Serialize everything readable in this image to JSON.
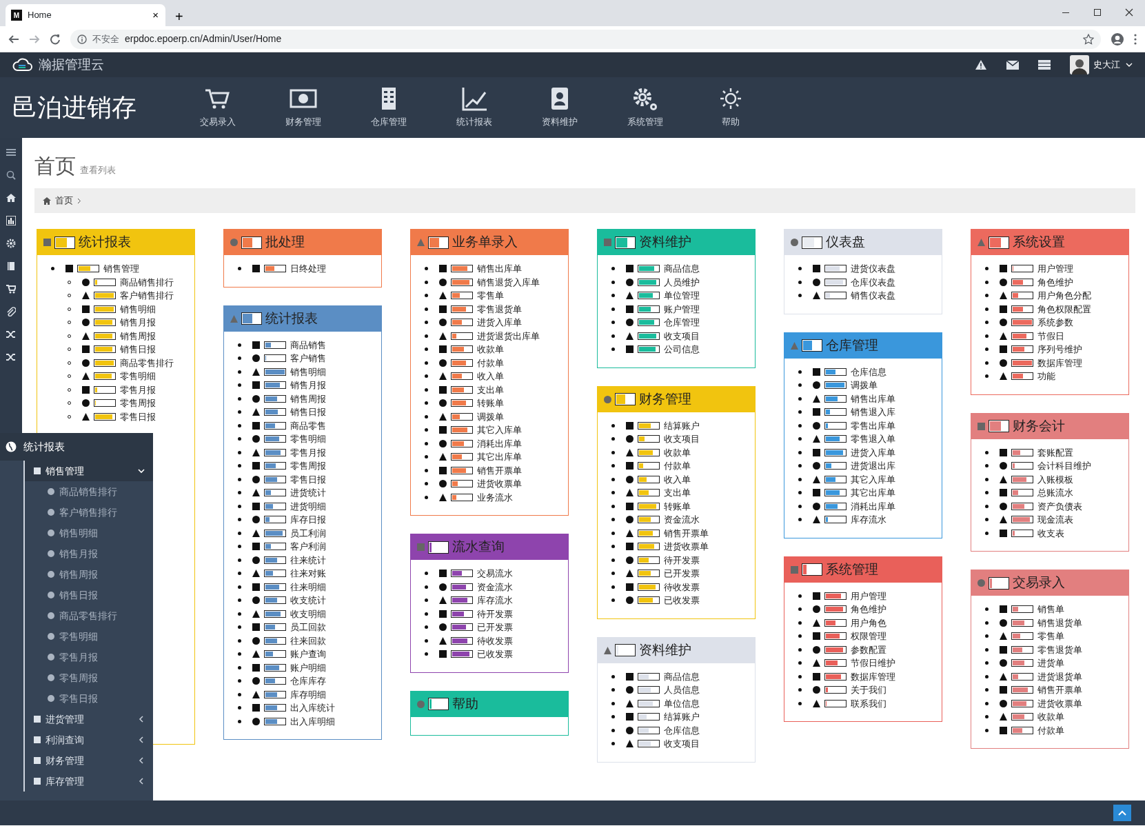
{
  "browser": {
    "favicon": "M",
    "tab_title": "Home",
    "tab_close": "×",
    "new_tab": "+",
    "security": "不安全",
    "url": "erpdoc.epoerp.cn/Admin/User/Home"
  },
  "app_bar": {
    "brand": "瀚据管理云",
    "user": "史大江"
  },
  "product_name": "邑泊进销存",
  "modules": [
    {
      "label": "交易录入"
    },
    {
      "label": "财务管理"
    },
    {
      "label": "仓库管理"
    },
    {
      "label": "统计报表"
    },
    {
      "label": "资料维护"
    },
    {
      "label": "系统管理"
    },
    {
      "label": "帮助"
    }
  ],
  "page": {
    "title": "首页",
    "subtitle": "查看列表",
    "breadcrumb": [
      "首页"
    ]
  },
  "columns": [
    [
      {
        "title": "统计报表",
        "color": "#f1c40f",
        "level": 0.6,
        "items": [
          {
            "label": "销售管理",
            "level": 0.6,
            "children": [
              {
                "label": "商品销售排行",
                "level": 0.1
              },
              {
                "label": "客户销售排行",
                "level": 0.95
              },
              {
                "label": "销售明细",
                "level": 0.95
              },
              {
                "label": "销售月报",
                "level": 0.9
              },
              {
                "label": "销售周报",
                "level": 0.9
              },
              {
                "label": "销售日报",
                "level": 0.9
              },
              {
                "label": "商品零售排行",
                "level": 0.95
              },
              {
                "label": "零售明细",
                "level": 0.85
              },
              {
                "label": "零售月报",
                "level": 0.1
              },
              {
                "label": "零售周报",
                "level": 0.05
              },
              {
                "label": "零售日报",
                "level": 0.9
              }
            ]
          }
        ]
      }
    ],
    [
      {
        "title": "批处理",
        "color": "#f07a4a",
        "level": 0.55,
        "items": [
          {
            "label": "日终处理",
            "level": 0.45
          }
        ]
      },
      {
        "title": "统计报表",
        "color": "#5b8ec4",
        "level": 0.55,
        "items": [
          {
            "label": "商品销售",
            "level": 0.3
          },
          {
            "label": "客户销售",
            "level": 0.05
          },
          {
            "label": "销售明细",
            "level": 1
          },
          {
            "label": "销售月报",
            "level": 0.75
          },
          {
            "label": "销售周报",
            "level": 0.6
          },
          {
            "label": "销售日报",
            "level": 0.65
          },
          {
            "label": "商品零售",
            "level": 0.5
          },
          {
            "label": "零售明细",
            "level": 0.7
          },
          {
            "label": "零售月报",
            "level": 0.8
          },
          {
            "label": "零售周报",
            "level": 0.55
          },
          {
            "label": "零售日报",
            "level": 0.6
          },
          {
            "label": "进货统计",
            "level": 0.3
          },
          {
            "label": "进货明细",
            "level": 0.4
          },
          {
            "label": "库存日报",
            "level": 0.2
          },
          {
            "label": "员工利润",
            "level": 0.9
          },
          {
            "label": "客户利润",
            "level": 0.3
          },
          {
            "label": "往来统计",
            "level": 0.6
          },
          {
            "label": "往来对账",
            "level": 0.4
          },
          {
            "label": "往来明细",
            "level": 0.7
          },
          {
            "label": "收支统计",
            "level": 0.6
          },
          {
            "label": "收支明细",
            "level": 0.8
          },
          {
            "label": "员工回款",
            "level": 0.5
          },
          {
            "label": "往来回款",
            "level": 0.6
          },
          {
            "label": "账户查询",
            "level": 0.4
          },
          {
            "label": "账户明细",
            "level": 0.7
          },
          {
            "label": "仓库库存",
            "level": 0.5
          },
          {
            "label": "库存明细",
            "level": 0.6
          },
          {
            "label": "出入库统计",
            "level": 0.6
          },
          {
            "label": "出入库明细",
            "level": 0.6
          }
        ]
      }
    ],
    [
      {
        "title": "业务单录入",
        "color": "#f07a4a",
        "level": 0.55,
        "items": [
          {
            "label": "销售出库单",
            "level": 0.8
          },
          {
            "label": "销售退货入库单",
            "level": 0.9
          },
          {
            "label": "零售单",
            "level": 0.4
          },
          {
            "label": "零售退货单",
            "level": 0.7
          },
          {
            "label": "进货入库单",
            "level": 0.5
          },
          {
            "label": "进货退货出库单",
            "level": 0.2
          },
          {
            "label": "收款单",
            "level": 0.6
          },
          {
            "label": "付款单",
            "level": 0.7
          },
          {
            "label": "收入单",
            "level": 0.5
          },
          {
            "label": "支出单",
            "level": 0.6
          },
          {
            "label": "转账单",
            "level": 0.7
          },
          {
            "label": "调拨单",
            "level": 0.4
          },
          {
            "label": "其它入库单",
            "level": 0.8
          },
          {
            "label": "消耗出库单",
            "level": 0.6
          },
          {
            "label": "其它出库单",
            "level": 0.5
          },
          {
            "label": "销售开票单",
            "level": 0.7
          },
          {
            "label": "进货收票单",
            "level": 0.3
          },
          {
            "label": "业务流水",
            "level": 0.2
          }
        ]
      },
      {
        "title": "流水查询",
        "color": "#8e44ad",
        "level": 0.1,
        "items": [
          {
            "label": "交易流水",
            "level": 0.5
          },
          {
            "label": "资金流水",
            "level": 0.7
          },
          {
            "label": "库存流水",
            "level": 0.8
          },
          {
            "label": "待开发票",
            "level": 0.6
          },
          {
            "label": "已开发票",
            "level": 0.7
          },
          {
            "label": "待收发票",
            "level": 0.8
          },
          {
            "label": "已收发票",
            "level": 0.9
          }
        ]
      },
      {
        "title": "帮助",
        "color": "#1abc9c",
        "level": 0.1
      }
    ],
    [
      {
        "title": "资料维护",
        "color": "#1abc9c",
        "level": 0.6,
        "items": [
          {
            "label": "商品信息",
            "level": 0.8
          },
          {
            "label": "人员维护",
            "level": 0.9
          },
          {
            "label": "单位管理",
            "level": 0.7
          },
          {
            "label": "账户管理",
            "level": 0.6
          },
          {
            "label": "仓库管理",
            "level": 0.8
          },
          {
            "label": "收支项目",
            "level": 0.9
          },
          {
            "label": "公司信息",
            "level": 0.85
          }
        ]
      },
      {
        "title": "财务管理",
        "color": "#f1c40f",
        "level": 0.5,
        "items": [
          {
            "label": "结算账户",
            "level": 0.6
          },
          {
            "label": "收支项目",
            "level": 0.3
          },
          {
            "label": "收款单",
            "level": 0.7
          },
          {
            "label": "付款单",
            "level": 0.2
          },
          {
            "label": "收入单",
            "level": 0.4
          },
          {
            "label": "支出单",
            "level": 0.5
          },
          {
            "label": "转账单",
            "level": 0.9
          },
          {
            "label": "资金流水",
            "level": 0.6
          },
          {
            "label": "销售开票单",
            "level": 0.7
          },
          {
            "label": "进货收票单",
            "level": 0.8
          },
          {
            "label": "待开发票",
            "level": 0.5
          },
          {
            "label": "已开发票",
            "level": 0.6
          },
          {
            "label": "待收发票",
            "level": 0.85
          },
          {
            "label": "已收发票",
            "level": 0.7
          }
        ]
      },
      {
        "title": "资料维护",
        "color": "#dde1ea",
        "level": 0.1,
        "items": [
          {
            "label": "商品信息",
            "level": 0.5
          },
          {
            "label": "人员信息",
            "level": 0.6
          },
          {
            "label": "单位信息",
            "level": 0.7
          },
          {
            "label": "结算账户",
            "level": 0.4
          },
          {
            "label": "仓库信息",
            "level": 0.5
          },
          {
            "label": "收支项目",
            "level": 0.6
          }
        ]
      }
    ],
    [
      {
        "title": "仪表盘",
        "color": "#dde1ea",
        "level": 0.6,
        "items": [
          {
            "label": "进货仪表盘",
            "level": 0.7
          },
          {
            "label": "仓库仪表盘",
            "level": 0.9
          },
          {
            "label": "销售仪表盘",
            "level": 0.2
          }
        ]
      },
      {
        "title": "仓库管理",
        "color": "#3a97dc",
        "level": 0.5,
        "items": [
          {
            "label": "仓库信息",
            "level": 0.5
          },
          {
            "label": "调拨单",
            "level": 0.95
          },
          {
            "label": "销售出库单",
            "level": 0.6
          },
          {
            "label": "销售退入库",
            "level": 0.2
          },
          {
            "label": "零售出库单",
            "level": 0.1
          },
          {
            "label": "零售退入单",
            "level": 0.7
          },
          {
            "label": "进货入库单",
            "level": 0.9
          },
          {
            "label": "进货退出库",
            "level": 0.3
          },
          {
            "label": "其它入库单",
            "level": 0.5
          },
          {
            "label": "其它出库单",
            "level": 0.7
          },
          {
            "label": "消耗出库单",
            "level": 0.6
          },
          {
            "label": "库存流水",
            "level": 0.1
          }
        ]
      },
      {
        "title": "系统管理",
        "color": "#e9605a",
        "level": 0.2,
        "items": [
          {
            "label": "用户管理",
            "level": 0.8
          },
          {
            "label": "角色维护",
            "level": 0.9
          },
          {
            "label": "用户角色",
            "level": 0.5
          },
          {
            "label": "权限管理",
            "level": 0.7
          },
          {
            "label": "参数配置",
            "level": 0.9
          },
          {
            "label": "节假日维护",
            "level": 0.6
          },
          {
            "label": "数据库管理",
            "level": 0.8
          },
          {
            "label": "关于我们",
            "level": 0.1
          },
          {
            "label": "联系我们",
            "level": 0.05
          }
        ]
      }
    ],
    [
      {
        "title": "系统设置",
        "color": "#ec6a5e",
        "level": 0.6,
        "items": [
          {
            "label": "用户管理",
            "level": 0.05
          },
          {
            "label": "角色维护",
            "level": 0.55
          },
          {
            "label": "用户角色分配",
            "level": 0.3
          },
          {
            "label": "角色权限配置",
            "level": 0.55
          },
          {
            "label": "系统参数",
            "level": 1
          },
          {
            "label": "节假日",
            "level": 0.7
          },
          {
            "label": "序列号维护",
            "level": 0.6
          },
          {
            "label": "数据库管理",
            "level": 1
          },
          {
            "label": "功能",
            "level": 0.55
          }
        ]
      },
      {
        "title": "财务会计",
        "color": "#e27f7f",
        "level": 0.6,
        "items": [
          {
            "label": "套账配置",
            "level": 0.4
          },
          {
            "label": "会计科目维护",
            "level": 0.1
          },
          {
            "label": "入账模板",
            "level": 0.7
          },
          {
            "label": "总账流水",
            "level": 0.3
          },
          {
            "label": "资产负债表",
            "level": 0.6
          },
          {
            "label": "现金流表",
            "level": 0.9
          },
          {
            "label": "收支表",
            "level": 0.1
          }
        ]
      },
      {
        "title": "交易录入",
        "color": "#e27f7f",
        "level": 0.1,
        "items": [
          {
            "label": "销售单",
            "level": 0.3
          },
          {
            "label": "销售退货单",
            "level": 0.6
          },
          {
            "label": "零售单",
            "level": 0.4
          },
          {
            "label": "零售退货单",
            "level": 0.5
          },
          {
            "label": "进货单",
            "level": 0.6
          },
          {
            "label": "进货退货单",
            "level": 0.3
          },
          {
            "label": "销售开票单",
            "level": 0.8
          },
          {
            "label": "进货收票单",
            "level": 0.7
          },
          {
            "label": "收款单",
            "level": 0.6
          },
          {
            "label": "付款单",
            "level": 0.5
          }
        ]
      }
    ]
  ],
  "flyout": {
    "title": "统计报表",
    "groups": [
      {
        "label": "销售管理",
        "expanded": true,
        "children": [
          {
            "label": "商品销售排行"
          },
          {
            "label": "客户销售排行"
          },
          {
            "label": "销售明细"
          },
          {
            "label": "销售月报"
          },
          {
            "label": "销售周报"
          },
          {
            "label": "销售日报"
          },
          {
            "label": "商品零售排行"
          },
          {
            "label": "零售明细"
          },
          {
            "label": "零售月报"
          },
          {
            "label": "零售周报"
          },
          {
            "label": "零售日报"
          }
        ]
      },
      {
        "label": "进货管理",
        "expanded": false
      },
      {
        "label": "利润查询",
        "expanded": false
      },
      {
        "label": "财务管理",
        "expanded": false
      },
      {
        "label": "库存管理",
        "expanded": false
      }
    ]
  }
}
